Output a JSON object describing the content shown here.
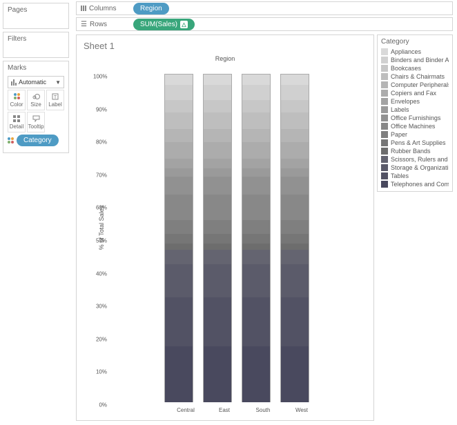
{
  "panels": {
    "pages": "Pages",
    "filters": "Filters",
    "marks": "Marks"
  },
  "marks": {
    "type": "Automatic",
    "cells": {
      "color": "Color",
      "size": "Size",
      "label": "Label",
      "detail": "Detail",
      "tooltip": "Tooltip"
    },
    "pill": "Category"
  },
  "shelves": {
    "columns_label": "Columns",
    "rows_label": "Rows",
    "columns_pill": "Region",
    "rows_pill": "SUM(Sales)"
  },
  "viz": {
    "sheet": "Sheet 1",
    "title": "Region",
    "ylabel": "% of Total Sales",
    "yticks": [
      "0%",
      "10%",
      "20%",
      "30%",
      "40%",
      "50%",
      "60%",
      "70%",
      "80%",
      "90%",
      "100%"
    ]
  },
  "legend": {
    "title": "Category"
  },
  "chart_data": {
    "type": "bar",
    "stacked": true,
    "normalized": true,
    "xlabel": "Region",
    "ylabel": "% of Total Sales",
    "ylim": [
      0,
      100
    ],
    "categories": [
      "Central",
      "East",
      "South",
      "West"
    ],
    "colors": [
      "#d9d9d9",
      "#d0d0d0",
      "#c7c7c7",
      "#bebebe",
      "#b5b5b5",
      "#acacac",
      "#a3a3a3",
      "#9a9a9a",
      "#919191",
      "#888888",
      "#7f7f7f",
      "#767676",
      "#6d6d6d",
      "#646470",
      "#5b5b6a",
      "#525264",
      "#49495e"
    ],
    "series": [
      {
        "name": "Appliances",
        "values": [
          3.2,
          3.2,
          3.2,
          3.2
        ]
      },
      {
        "name": "Binders and Binder A..",
        "values": [
          4.5,
          4.5,
          4.5,
          4.5
        ]
      },
      {
        "name": "Bookcases",
        "values": [
          3.8,
          3.8,
          3.8,
          3.8
        ]
      },
      {
        "name": "Chairs & Chairmats",
        "values": [
          5.2,
          5.2,
          5.2,
          5.2
        ]
      },
      {
        "name": "Computer Peripherals",
        "values": [
          4.0,
          4.0,
          4.0,
          4.0
        ]
      },
      {
        "name": "Copiers and Fax",
        "values": [
          5.0,
          5.0,
          5.0,
          5.0
        ]
      },
      {
        "name": "Envelopes",
        "values": [
          3.0,
          3.0,
          3.0,
          3.0
        ]
      },
      {
        "name": "Labels",
        "values": [
          2.5,
          2.5,
          2.5,
          2.5
        ]
      },
      {
        "name": "Office Furnishings",
        "values": [
          5.5,
          5.5,
          5.5,
          5.5
        ]
      },
      {
        "name": "Office Machines",
        "values": [
          7.8,
          7.8,
          7.8,
          7.8
        ]
      },
      {
        "name": "Paper",
        "values": [
          4.2,
          4.2,
          4.2,
          4.2
        ]
      },
      {
        "name": "Pens & Art Supplies",
        "values": [
          2.8,
          2.8,
          2.8,
          2.8
        ]
      },
      {
        "name": "Rubber Bands",
        "values": [
          2.0,
          2.0,
          2.0,
          2.0
        ]
      },
      {
        "name": "Scissors, Rulers and ..",
        "values": [
          4.5,
          4.5,
          4.5,
          4.5
        ]
      },
      {
        "name": "Storage & Organizati..",
        "values": [
          10.0,
          10.0,
          10.0,
          10.0
        ]
      },
      {
        "name": "Tables",
        "values": [
          15.0,
          15.0,
          15.0,
          15.0
        ]
      },
      {
        "name": "Telephones and Com..",
        "values": [
          17.0,
          17.0,
          17.0,
          17.0
        ]
      }
    ]
  }
}
